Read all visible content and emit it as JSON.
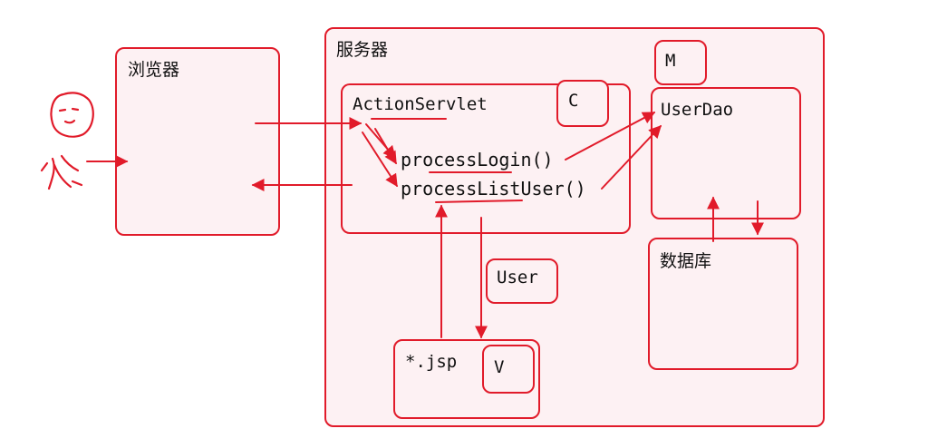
{
  "browser": {
    "label": "浏览器"
  },
  "server": {
    "label": "服务器"
  },
  "controller": {
    "name": "ActionServlet",
    "tag": "C"
  },
  "methods": {
    "login": "processLogin()",
    "list_user": "processListUser()"
  },
  "model": {
    "tag": "M",
    "dao": "UserDao"
  },
  "database": {
    "label": "数据库"
  },
  "entity": {
    "label": "User"
  },
  "view": {
    "file": "*.jsp",
    "tag": "V"
  },
  "colors": {
    "accent": "#e11b2a",
    "fill": "#fdf1f3",
    "text": "#111111"
  },
  "icons": {
    "user": "stick-figure-icon"
  }
}
